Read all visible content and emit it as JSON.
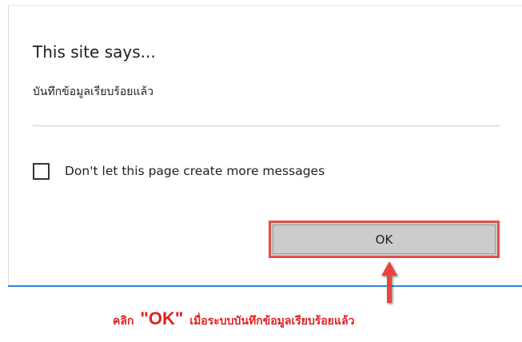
{
  "dialog": {
    "title": "This site says...",
    "message": "บันทึกข้อมูลเรียบร้อยแล้ว",
    "checkbox_label": "Don't let this page create more messages",
    "checkbox_checked": false,
    "ok_label": "OK"
  },
  "annotation": {
    "part1": "คลิก",
    "ok": "\"OK\"",
    "part2": "เมื่อระบบบันทึกข้อมูลเรียบร้อยแล้ว"
  },
  "colors": {
    "highlight": "#e0504a",
    "annotation_text": "#e02020",
    "button_bg": "#cccccc",
    "accent_line": "#2b88d8"
  },
  "icons": {
    "checkbox": "checkbox-unchecked-icon",
    "arrow": "arrow-up-icon"
  }
}
